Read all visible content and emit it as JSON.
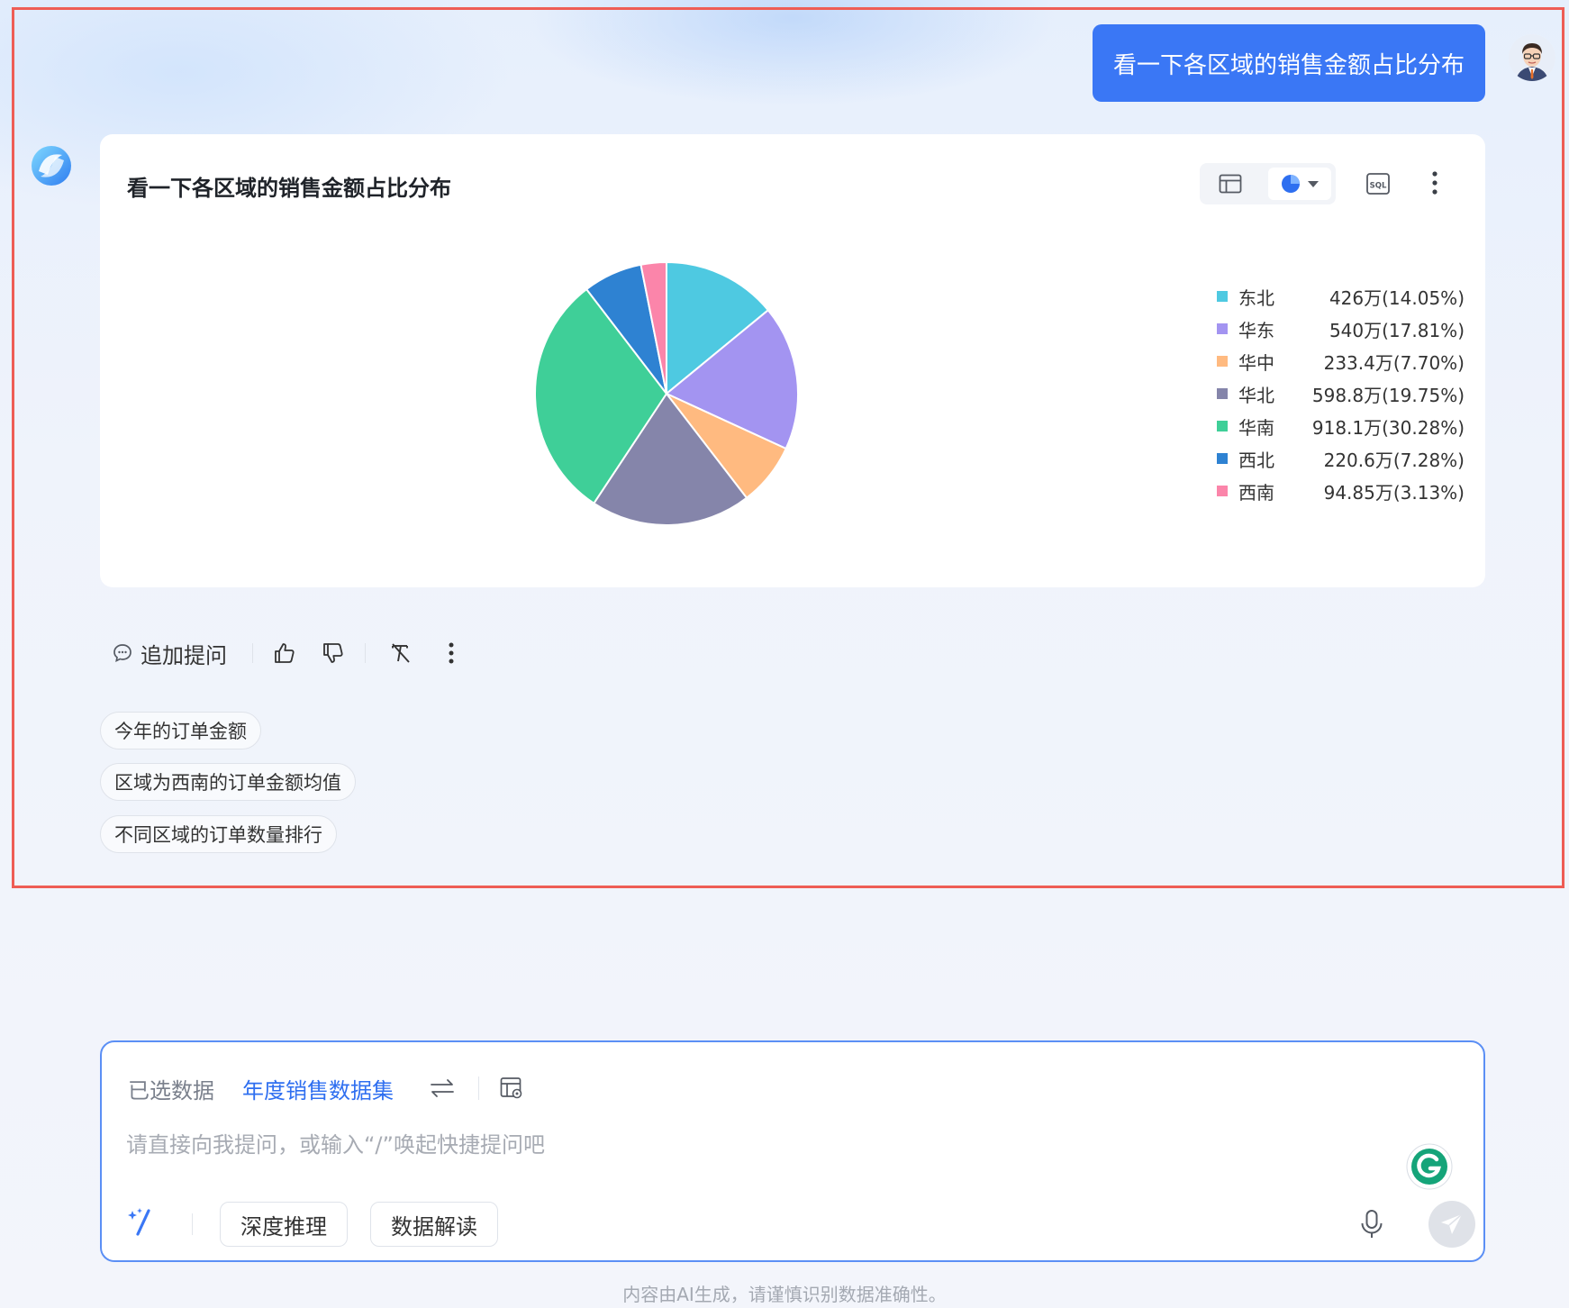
{
  "conversation": {
    "user_message": "看一下各区域的销售金额占比分布"
  },
  "chart_card": {
    "title": "看一下各区域的销售金额占比分布",
    "icons": {
      "table_view": "table-icon",
      "pie_view": "pie-chart-icon",
      "dropdown": "caret-down-icon",
      "sql": "sql-icon",
      "more": "more-vertical-icon"
    }
  },
  "chart_data": {
    "type": "pie",
    "title": "",
    "categories": [
      "东北",
      "华东",
      "华中",
      "华北",
      "华南",
      "西北",
      "西南"
    ],
    "values": [
      426,
      540,
      233.4,
      598.8,
      918.1,
      220.6,
      94.85
    ],
    "percentages": [
      14.05,
      17.81,
      7.7,
      19.75,
      30.28,
      7.28,
      3.13
    ],
    "labels": [
      "426万(14.05%)",
      "540万(17.81%)",
      "233.4万(7.70%)",
      "598.8万(19.75%)",
      "918.1万(30.28%)",
      "220.6万(7.28%)",
      "94.85万(3.13%)"
    ],
    "colors": [
      "#4ec9e1",
      "#a394f1",
      "#ffba80",
      "#8585aa",
      "#3fcf98",
      "#2e82d2",
      "#fb85aa"
    ],
    "legend_position": "right"
  },
  "actions": {
    "follow_up_label": "追加提问",
    "icons": [
      "chat-bubble-icon",
      "thumbs-up-icon",
      "thumbs-down-icon",
      "clear-format-icon",
      "more-vertical-icon"
    ]
  },
  "suggestions": [
    "今年的订单金额",
    "区域为西南的订单金额均值",
    "不同区域的订单数量排行"
  ],
  "input": {
    "dataset_label": "已选数据",
    "dataset_name": "年度销售数据集",
    "placeholder": "请直接向我提问，或输入“/”唤起快捷提问吧",
    "value": "",
    "chips": [
      "深度推理",
      "数据解读"
    ]
  },
  "footer": {
    "disclaimer": "内容由AI生成，请谨慎识别数据准确性。"
  },
  "colors": {
    "accent": "#3a77f5",
    "frame": "#ee5d55"
  }
}
